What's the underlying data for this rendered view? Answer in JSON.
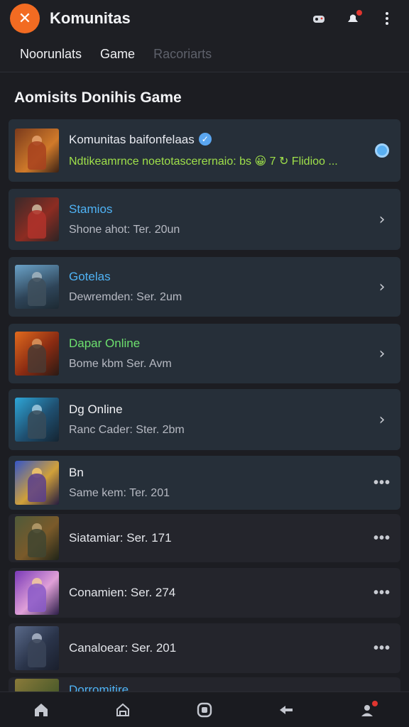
{
  "header": {
    "logo_glyph": "✕",
    "title": "Komunitas"
  },
  "tabs": [
    {
      "label": "Noorunlats"
    },
    {
      "label": "Game"
    },
    {
      "label": "Racoriarts"
    }
  ],
  "section_title": "Aomisits Donihis Game",
  "featured": {
    "title": "Komunitas baifonfelaas",
    "subtitle": "Ndtikeamrnce noetotascerernaio: bs 😀 7 ↻ Flidioo ...",
    "accent": "#9fe04a"
  },
  "items": [
    {
      "title": "Stamios",
      "subtitle": "Shone ahot: Ter. 20un",
      "title_color": "#4fb3f5",
      "trail": "chevron"
    },
    {
      "title": "Gotelas",
      "subtitle": "Dewremden: Ser. 2um",
      "title_color": "#4fb3f5",
      "trail": "chevron"
    },
    {
      "title": "Dapar Online",
      "subtitle": "Bome kbm Ser. Avm",
      "title_color": "#6de06e",
      "trail": "chevron"
    },
    {
      "title": "Dg Online",
      "subtitle": "Ranc Cader: Ster. 2bm",
      "title_color": "#f0f1f4",
      "trail": "chevron"
    },
    {
      "title": "Bn",
      "subtitle": "Same kem: Ter. 201",
      "title_color": "#f0f1f4",
      "trail": "more"
    }
  ],
  "compact_items": [
    {
      "label": "Siatamiar: Ser. 171"
    },
    {
      "label": "Conamien: Ser. 274"
    },
    {
      "label": "Canaloear: Ser. 201"
    }
  ],
  "partial_item": {
    "label": "Dorromitire"
  },
  "colors": {
    "brand": "#f26b22",
    "link_blue": "#4fb3f5",
    "green": "#6de06e"
  }
}
